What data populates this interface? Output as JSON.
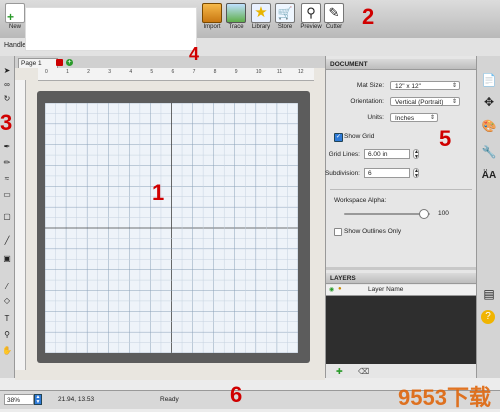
{
  "toolbar": {
    "new_label": "New",
    "import_label": "Import",
    "trace_label": "Trace",
    "library_label": "Library",
    "store_label": "Store",
    "preview_label": "Preview",
    "cutter_label": "Cutter"
  },
  "bar2": {
    "handle_label": "Handle"
  },
  "canvas": {
    "page_tab": "Page 1",
    "ruler_top_labels": [
      "0",
      "1",
      "2",
      "3",
      "4",
      "5",
      "6",
      "7",
      "8",
      "9",
      "10",
      "11",
      "12"
    ]
  },
  "document_panel": {
    "header": "DOCUMENT",
    "mat_size_label": "Mat Size:",
    "mat_size_value": "12\" x 12\"",
    "orientation_label": "Orientation:",
    "orientation_value": "Vertical (Portrait)",
    "units_label": "Units:",
    "units_value": "Inches",
    "show_grid_label": "Show Grid",
    "show_grid_checked": true,
    "grid_lines_label": "Grid Lines:",
    "grid_lines_value": "6.00 in",
    "subdivision_label": "Subdivision:",
    "subdivision_value": "6",
    "workspace_alpha_label": "Workspace Alpha:",
    "workspace_alpha_value": "100",
    "workspace_alpha_level": 0.92,
    "show_outlines_label": "Show Outlines Only",
    "show_outlines_checked": false
  },
  "layers_panel": {
    "header": "LAYERS",
    "column_label": "Layer Name"
  },
  "status": {
    "zoom": "38%",
    "coords": "21.94, 13.53",
    "state": "Ready"
  },
  "annotations": [
    "1",
    "2",
    "3",
    "4",
    "5",
    "6"
  ],
  "watermark": "9553下载",
  "colors": {
    "annotation": "#d00000",
    "mat": "#5c5c5c",
    "grid_bg": "#eef3f9",
    "accent": "#2f7bd8"
  }
}
